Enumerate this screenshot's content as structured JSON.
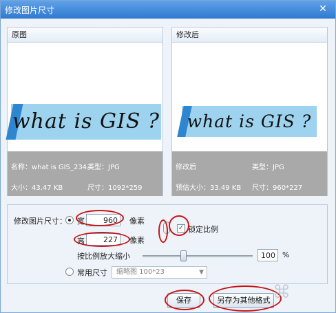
{
  "window": {
    "title": "修改图片尺寸",
    "close_glyph": "✕"
  },
  "original": {
    "header": "原图",
    "image_text": "what is GIS ?",
    "name": "名称：what is GIS_234...",
    "type": "类型：JPG",
    "size": "大小：43.47 KB",
    "dimensions": "尺寸：1092*259"
  },
  "modified": {
    "header": "修改后",
    "image_text": "what is GIS ?",
    "name": "修改后",
    "type": "类型：JPG",
    "size": "预估大小：33.49 KB",
    "dimensions": "尺寸：960*227"
  },
  "settings": {
    "resize_label": "修改图片尺寸：",
    "width_label": "宽",
    "width_value": "960",
    "height_label": "高",
    "height_value": "227",
    "unit_px": "像素",
    "lock_ratio_label": "锁定比例",
    "lock_ratio_checked": true,
    "scale_label": "按比例放大缩小",
    "scale_value": "100",
    "scale_unit": "%",
    "scale_fraction": 0.37,
    "common_size_label": "常用尺寸",
    "common_size_selected": "缩略图 100*23"
  },
  "buttons": {
    "save": "保存",
    "save_as": "另存为其他格式"
  },
  "annotation_color": "#c81414"
}
